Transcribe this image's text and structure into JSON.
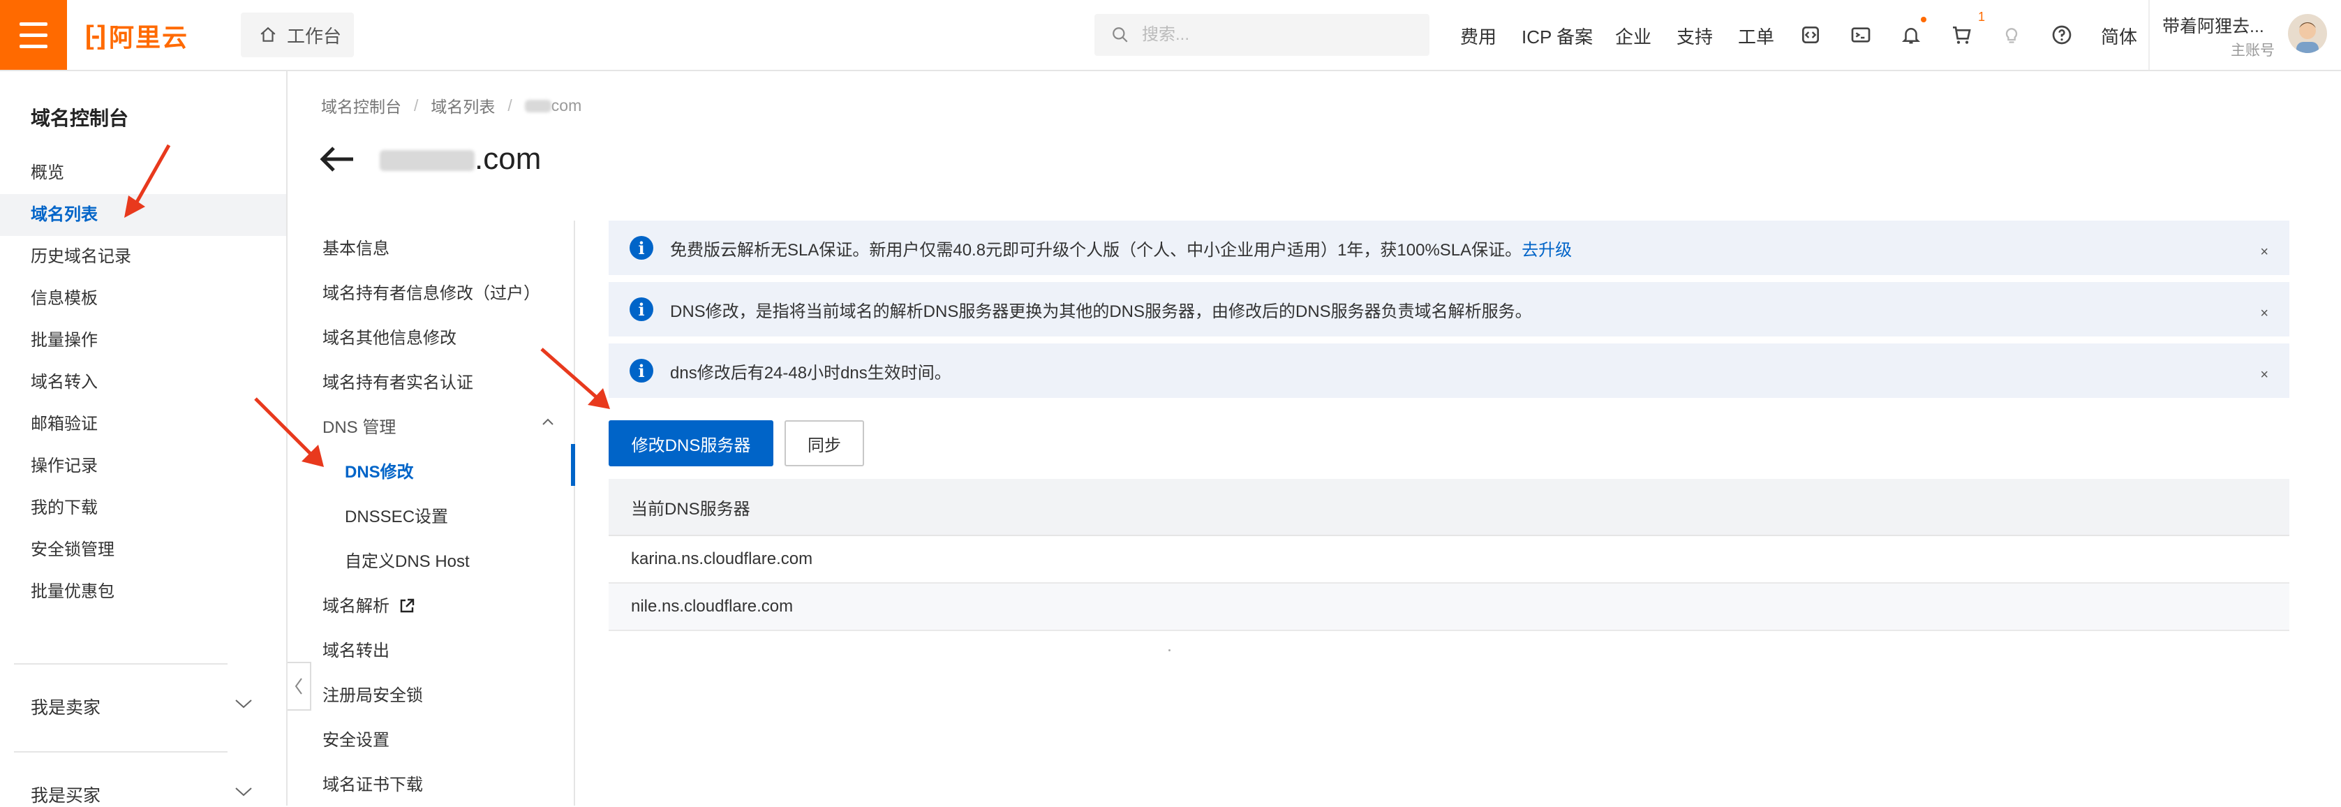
{
  "colors": {
    "brand": "#ff6a00",
    "accent": "#0064c8",
    "annotation_arrow": "#e8391d"
  },
  "topbar": {
    "logo_text": "阿里云",
    "workbench_label": "工作台",
    "search_placeholder": "搜索...",
    "nav_links": [
      "费用",
      "ICP 备案",
      "企业",
      "支持",
      "工单"
    ],
    "icons": [
      "code-icon",
      "terminal-icon",
      "bell-icon",
      "cart-icon",
      "lightbulb-icon",
      "help-icon"
    ],
    "cart_badge": "1",
    "language": "简体",
    "account_name": "带着阿狸去...",
    "account_role": "主账号"
  },
  "sidebar": {
    "title": "域名控制台",
    "items": [
      "概览",
      "域名列表",
      "历史域名记录",
      "信息模板",
      "批量操作",
      "域名转入",
      "邮箱验证",
      "操作记录",
      "我的下载",
      "安全锁管理",
      "批量优惠包"
    ],
    "active_index": 1,
    "groups": [
      "我是卖家",
      "我是买家"
    ]
  },
  "breadcrumb": [
    "域名控制台",
    "域名列表",
    "com"
  ],
  "page": {
    "title": ".com"
  },
  "subnav": {
    "items": [
      {
        "label": "基本信息"
      },
      {
        "label": "域名持有者信息修改（过户）"
      },
      {
        "label": "域名其他信息修改"
      },
      {
        "label": "域名持有者实名认证"
      },
      {
        "label": "DNS 管理"
      },
      {
        "label": "DNS修改"
      },
      {
        "label": "DNSSEC设置"
      },
      {
        "label": "自定义DNS Host"
      },
      {
        "label": "域名解析"
      },
      {
        "label": "域名转出"
      },
      {
        "label": "注册局安全锁"
      },
      {
        "label": "安全设置"
      },
      {
        "label": "域名证书下载"
      }
    ],
    "active_label": "DNS修改"
  },
  "alerts": [
    {
      "text": "免费版云解析无SLA保证。新用户仅需40.8元即可升级个人版（个人、中小企业用户适用）1年，获100%SLA保证。",
      "link": "去升级"
    },
    {
      "text": "DNS修改，是指将当前域名的解析DNS服务器更换为其他的DNS服务器，由修改后的DNS服务器负责域名解析服务。",
      "link": ""
    },
    {
      "text": "dns修改后有24-48小时dns生效时间。",
      "link": ""
    }
  ],
  "alert_close": "×",
  "buttons": {
    "modify_dns": "修改DNS服务器",
    "sync": "同步"
  },
  "dns_table": {
    "header": "当前DNS服务器",
    "rows": [
      "karina.ns.cloudflare.com",
      "nile.ns.cloudflare.com"
    ]
  }
}
